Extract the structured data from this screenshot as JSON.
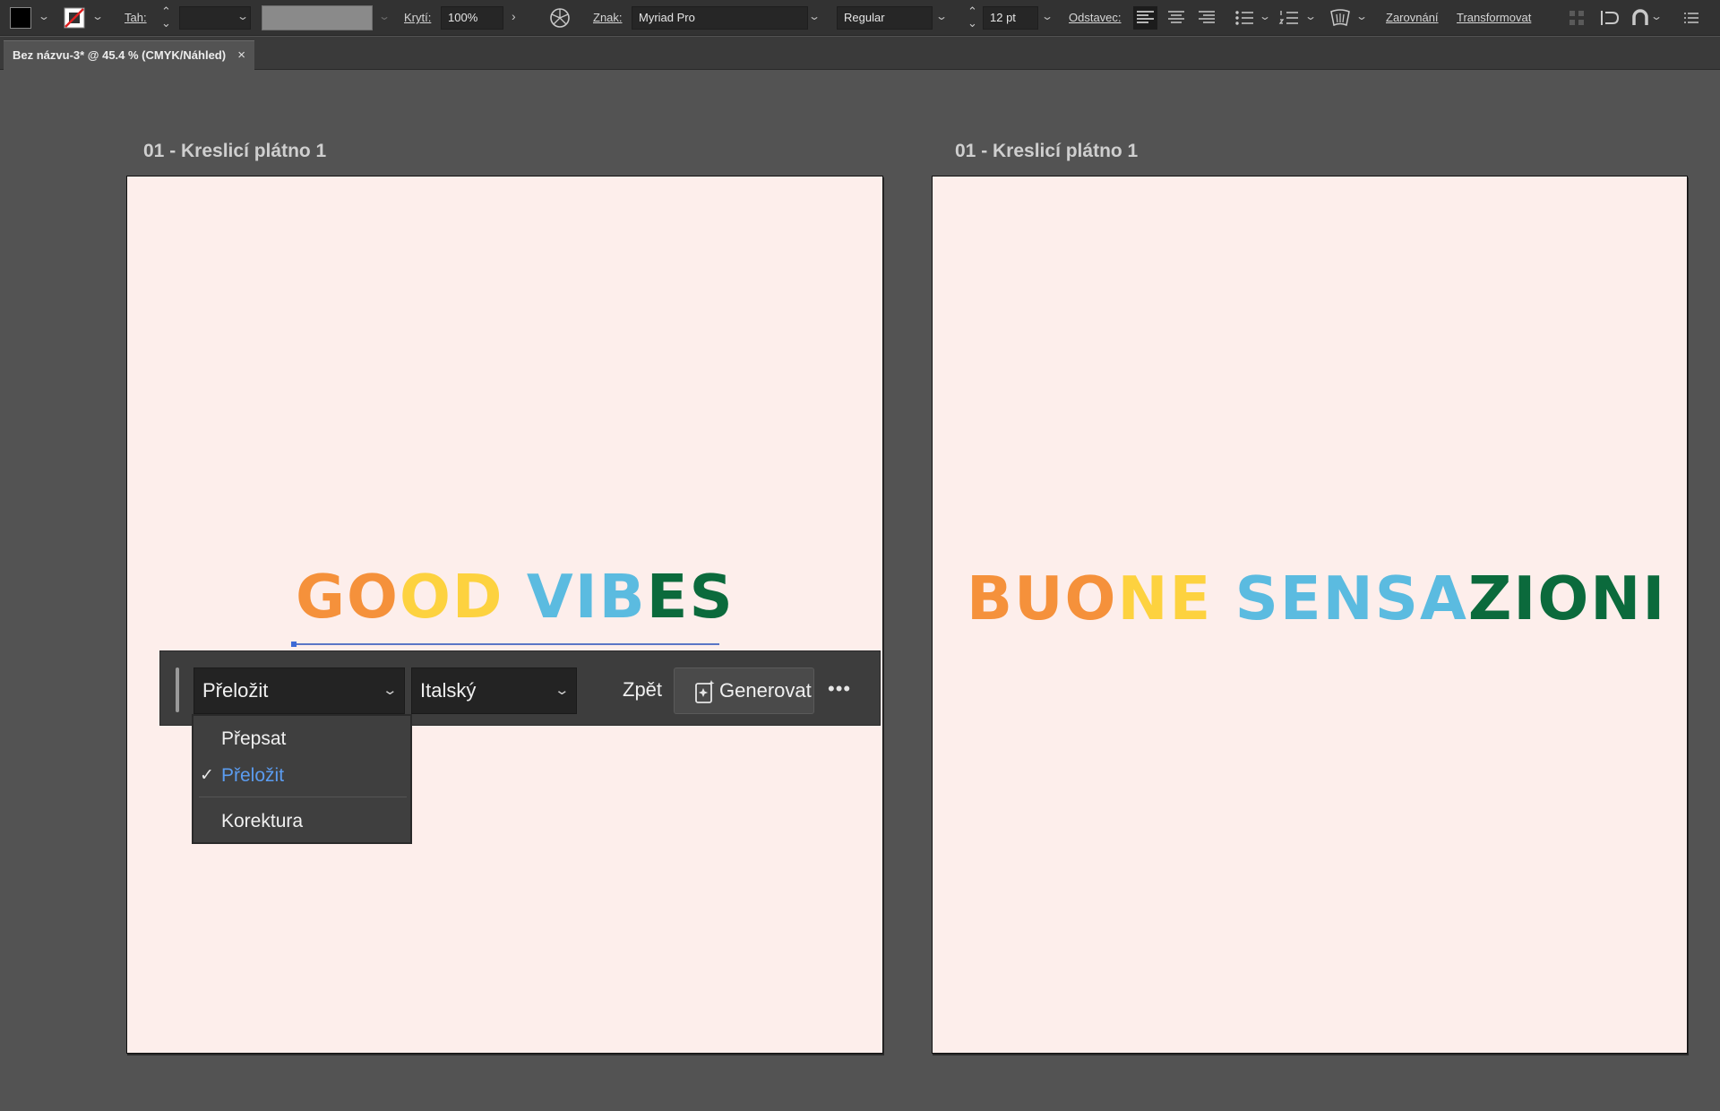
{
  "control_bar": {
    "stroke_label": "Tah:",
    "opacity_label": "Krytí:",
    "opacity_value": "100%",
    "character_label": "Znak:",
    "font_family": "Myriad Pro",
    "font_style": "Regular",
    "font_size": "12 pt",
    "paragraph_label": "Odstavec:",
    "align_label": "Zarovnání",
    "transform_label": "Transformovat",
    "fill_color": "#000000",
    "stroke_color": "none"
  },
  "document_tab": {
    "title": "Bez názvu-3* @ 45.4 % (CMYK/Náhled)",
    "close_label": "×"
  },
  "artboards": [
    {
      "label": "01 - Kreslicí plátno 1",
      "text_runs": [
        {
          "text": "GOOD ",
          "color": "#f5913b"
        },
        {
          "text": "VIB",
          "color": "#5bbbe0"
        },
        {
          "text": "ES",
          "color": "#0b6a3c"
        }
      ],
      "text_run_colors_detail": [
        "#f5913b",
        "#f5913b",
        "#fdd23f",
        "#fdd23f",
        "#5bbbe0",
        "#0b6a3c"
      ]
    },
    {
      "label": "01 - Kreslicí plátno 1",
      "text_runs": [
        {
          "text": "BUO",
          "color": "#f5913b"
        },
        {
          "text": "NE ",
          "color": "#fdd23f"
        },
        {
          "text": "SENSA",
          "color": "#5bbbe0"
        },
        {
          "text": "ZIONI",
          "color": "#0b6a3c"
        }
      ]
    }
  ],
  "task_bar": {
    "action_select": "Přeložit",
    "language_select": "Italský",
    "back_label": "Zpět",
    "generate_label": "Generovat",
    "more_label": "•••"
  },
  "action_menu": {
    "items": [
      {
        "label": "Přepsat",
        "selected": false
      },
      {
        "label": "Přeložit",
        "selected": true
      },
      {
        "label": "Korektura",
        "selected": false
      }
    ],
    "check_mark": "✓"
  },
  "colors": {
    "orange": "#f5913b",
    "yellow": "#fdd23f",
    "light_blue": "#5bbbe0",
    "dark_green": "#0b6a3c",
    "selected_menu_item": "#5b9cf0",
    "artboard_bg": "#fdeeeb"
  },
  "icons": {
    "fill_swatch": "fill-swatch-icon",
    "stroke_swatch": "stroke-none-swatch-icon",
    "recolor": "recolor-artwork-icon",
    "align_left": "align-left-icon",
    "align_center": "align-center-icon",
    "align_right": "align-right-icon",
    "bullets": "bullet-list-icon",
    "numbering": "numbered-list-icon",
    "envelope": "text-envelope-icon",
    "generate": "generate-sparkle-icon"
  }
}
